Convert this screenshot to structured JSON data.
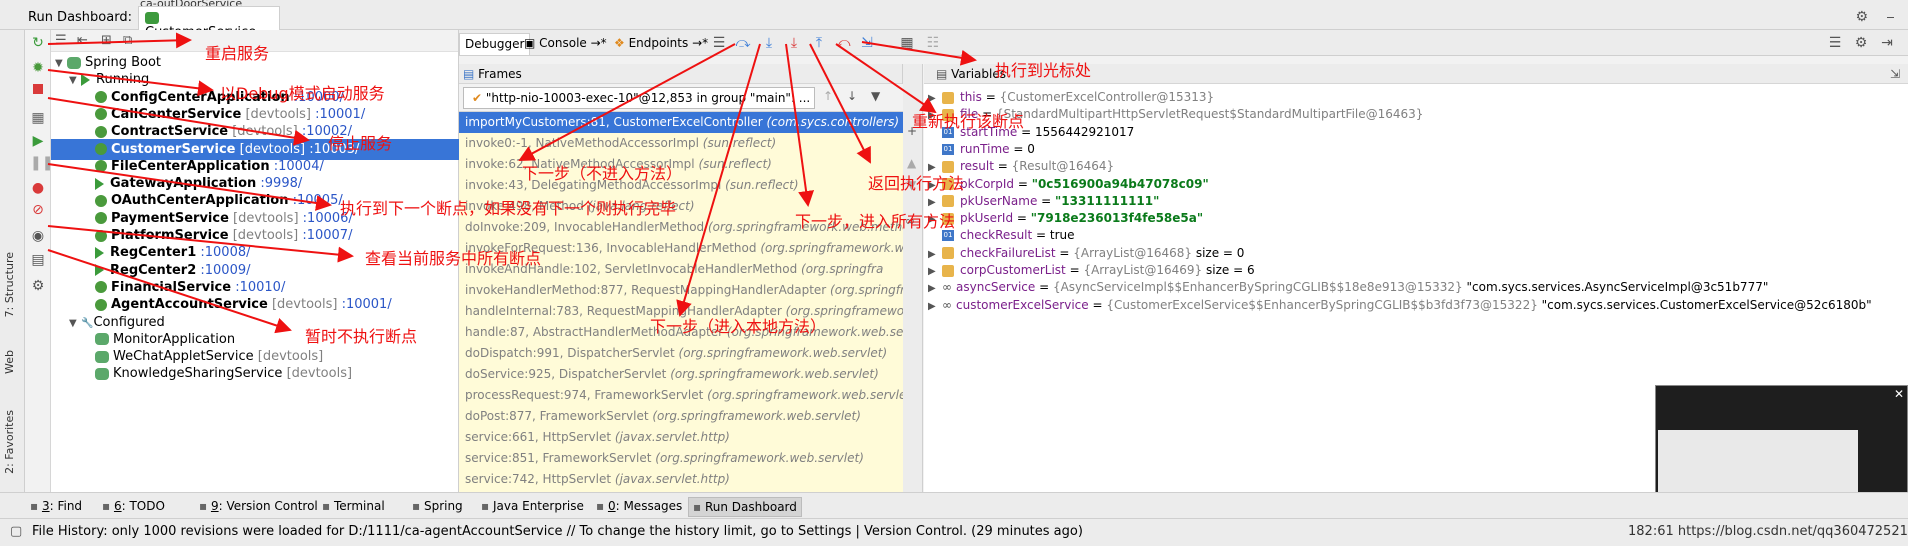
{
  "topbar": {
    "strip_label": "ca-outDoorService",
    "run_label": "Run Dashboard:",
    "run_tab": "CustomerService",
    "close_glyph": "×"
  },
  "vertical_tabs": {
    "structure": "7: Structure",
    "web": "Web",
    "favorites": "2: Favorites"
  },
  "services": {
    "root": "Spring Boot",
    "running_group": "Running",
    "configured_group": "Configured",
    "running": [
      {
        "name": "ConfigCenterApplication",
        "tag": "",
        "port": ":10000/"
      },
      {
        "name": "CallCenterService",
        "tag": "[devtools]",
        "port": ":10001/"
      },
      {
        "name": "ContractService",
        "tag": "[devtools]",
        "port": ":10002/"
      },
      {
        "name": "CustomerService",
        "tag": "[devtools]",
        "port": ":10003/"
      },
      {
        "name": "FileCenterApplication",
        "tag": "",
        "port": ":10004/"
      },
      {
        "name": "GatewayApplication",
        "tag": "",
        "port": ":9998/"
      },
      {
        "name": "OAuthCenterApplication",
        "tag": "",
        "port": ":10005/"
      },
      {
        "name": "PaymentService",
        "tag": "[devtools]",
        "port": ":10006/"
      },
      {
        "name": "PlatformService",
        "tag": "[devtools]",
        "port": ":10007/"
      },
      {
        "name": "RegCenter1",
        "tag": "",
        "port": ":10008/"
      },
      {
        "name": "RegCenter2",
        "tag": "",
        "port": ":10009/"
      },
      {
        "name": "FinancialService",
        "tag": "",
        "port": ":10010/"
      },
      {
        "name": "AgentAccountService",
        "tag": "[devtools]",
        "port": ":10001/"
      }
    ],
    "configured": [
      {
        "name": "MonitorApplication",
        "tag": ""
      },
      {
        "name": "WeChatAppletService",
        "tag": "[devtools]"
      },
      {
        "name": "KnowledgeSharingService",
        "tag": "[devtools]"
      }
    ]
  },
  "debugger": {
    "tabs": [
      "Debugger",
      "Console",
      "Endpoints"
    ],
    "frames_title": "Frames",
    "variables_title": "Variables",
    "thread": "\"http-nio-10003-exec-10\"@12,853 in group \"main\": ...",
    "frames": [
      {
        "method": "importMyCustomers:81, CustomerExcelController",
        "pkg": "(com.sycs.controllers)"
      },
      {
        "method": "invoke0:-1, NativeMethodAccessorImpl",
        "pkg": "(sun.reflect)"
      },
      {
        "method": "invoke:62, NativeMethodAccessorImpl",
        "pkg": "(sun.reflect)"
      },
      {
        "method": "invoke:43, DelegatingMethodAccessorImpl",
        "pkg": "(sun.reflect)"
      },
      {
        "method": "invoke:498, Method",
        "pkg": "(java.lang.reflect)"
      },
      {
        "method": "doInvoke:209, InvocableHandlerMethod",
        "pkg": "(org.springframework.web.method"
      },
      {
        "method": "invokeForRequest:136, InvocableHandlerMethod",
        "pkg": "(org.springframework.web.m"
      },
      {
        "method": "invokeAndHandle:102, ServletInvocableHandlerMethod",
        "pkg": "(org.springfra"
      },
      {
        "method": "invokeHandlerMethod:877, RequestMappingHandlerAdapter",
        "pkg": "(org.springfra"
      },
      {
        "method": "handleInternal:783, RequestMappingHandlerAdapter",
        "pkg": "(org.springframework"
      },
      {
        "method": "handle:87, AbstractHandlerMethodAdapter",
        "pkg": "(org.springframework.web.serv"
      },
      {
        "method": "doDispatch:991, DispatcherServlet",
        "pkg": "(org.springframework.web.servlet)"
      },
      {
        "method": "doService:925, DispatcherServlet",
        "pkg": "(org.springframework.web.servlet)"
      },
      {
        "method": "processRequest:974, FrameworkServlet",
        "pkg": "(org.springframework.web.servlet)"
      },
      {
        "method": "doPost:877, FrameworkServlet",
        "pkg": "(org.springframework.web.servlet)"
      },
      {
        "method": "service:661, HttpServlet",
        "pkg": "(javax.servlet.http)"
      },
      {
        "method": "service:851, FrameworkServlet",
        "pkg": "(org.springframework.web.servlet)"
      },
      {
        "method": "service:742, HttpServlet",
        "pkg": "(javax.servlet.http)"
      }
    ],
    "variables": [
      {
        "exp": "▶",
        "icon": "field",
        "name": "this",
        "eq": " = ",
        "gray": "{CustomerExcelController@15313}",
        "val": ""
      },
      {
        "exp": "▶",
        "icon": "field",
        "name": "file",
        "eq": " = ",
        "gray": "{StandardMultipartHttpServletRequest$StandardMultipartFile@16463}",
        "val": ""
      },
      {
        "exp": "",
        "icon": "prim",
        "name": "startTime",
        "eq": " = ",
        "gray": "",
        "val": "1556442921017"
      },
      {
        "exp": "",
        "icon": "prim",
        "name": "runTime",
        "eq": " = ",
        "gray": "",
        "val": "0"
      },
      {
        "exp": "▶",
        "icon": "field",
        "name": "result",
        "eq": " = ",
        "gray": "{Result@16464}",
        "val": ""
      },
      {
        "exp": "▶",
        "icon": "field",
        "name": "pkCorpId",
        "eq": " = ",
        "gray": "",
        "str": "\"0c516900a94b47078c09\""
      },
      {
        "exp": "▶",
        "icon": "field",
        "name": "pkUserName",
        "eq": " = ",
        "gray": "",
        "str": "\"13311111111\""
      },
      {
        "exp": "▶",
        "icon": "field",
        "name": "pkUserId",
        "eq": " = ",
        "gray": "",
        "str": "\"7918e236013f4fe58e5a\""
      },
      {
        "exp": "",
        "icon": "prim",
        "name": "checkResult",
        "eq": " = ",
        "gray": "",
        "val": "true"
      },
      {
        "exp": "▶",
        "icon": "field",
        "name": "checkFailureList",
        "eq": " = ",
        "gray": "{ArrayList@16468}",
        "val": "  size = 0"
      },
      {
        "exp": "▶",
        "icon": "field",
        "name": "corpCustomerList",
        "eq": " = ",
        "gray": "{ArrayList@16469}",
        "val": "  size = 6"
      },
      {
        "exp": "▶",
        "icon": "inf",
        "name": "asyncService",
        "eq": " = ",
        "gray": "{AsyncServiceImpl$$EnhancerBySpringCGLIB$$18e8e913@15332}",
        "val": " \"com.sycs.services.AsyncServiceImpl@3c51b777\""
      },
      {
        "exp": "▶",
        "icon": "inf",
        "name": "customerExcelService",
        "eq": " = ",
        "gray": "{CustomerExcelService$$EnhancerBySpringCGLIB$$b3fd3f73@15322}",
        "val": " \"com.sycs.services.CustomerExcelService@52c6180b\""
      }
    ]
  },
  "bottom_tabs": [
    {
      "num": "3",
      "rest": ": Find"
    },
    {
      "num": "6",
      "rest": ": TODO"
    },
    {
      "num": "9",
      "rest": ": Version Control"
    },
    {
      "num": "",
      "rest": "Terminal"
    },
    {
      "num": "",
      "rest": "Spring"
    },
    {
      "num": "",
      "rest": "Java Enterprise"
    },
    {
      "num": "0",
      "rest": ": Messages"
    },
    {
      "num": "",
      "rest": "Run Dashboard"
    }
  ],
  "status": {
    "text": "File History: only 1000 revisions were loaded for D:/1111/ca-agentAccountService // To change the history limit, go to Settings | Version Control. (29 minutes ago)",
    "right": "182:61  https://blog.csdn.net/qq360472521"
  },
  "annotations": {
    "restart": "重启服务",
    "debug_start": "以Debug模式启动服务",
    "stop": "停止服务",
    "next_breakpoint": "执行到下一个断点，如果没有下一个则执行完毕",
    "view_breakpoints": "查看当前服务中所有断点",
    "mute_breakpoints": "暂时不执行断点",
    "run_to_cursor": "执行到光标处",
    "rerun_method": "重新执行该断点",
    "step_over": "下一步（不进入方法）",
    "step_out": "返回执行方法",
    "force_step_into": "下一步，进入所有方法",
    "step_into": "下一步（进入本地方法）"
  },
  "colors": {
    "selection": "#3875d7",
    "annotation": "#ee1111",
    "frames_bg": "#fffbd8",
    "port_link": "#2b56c7"
  }
}
